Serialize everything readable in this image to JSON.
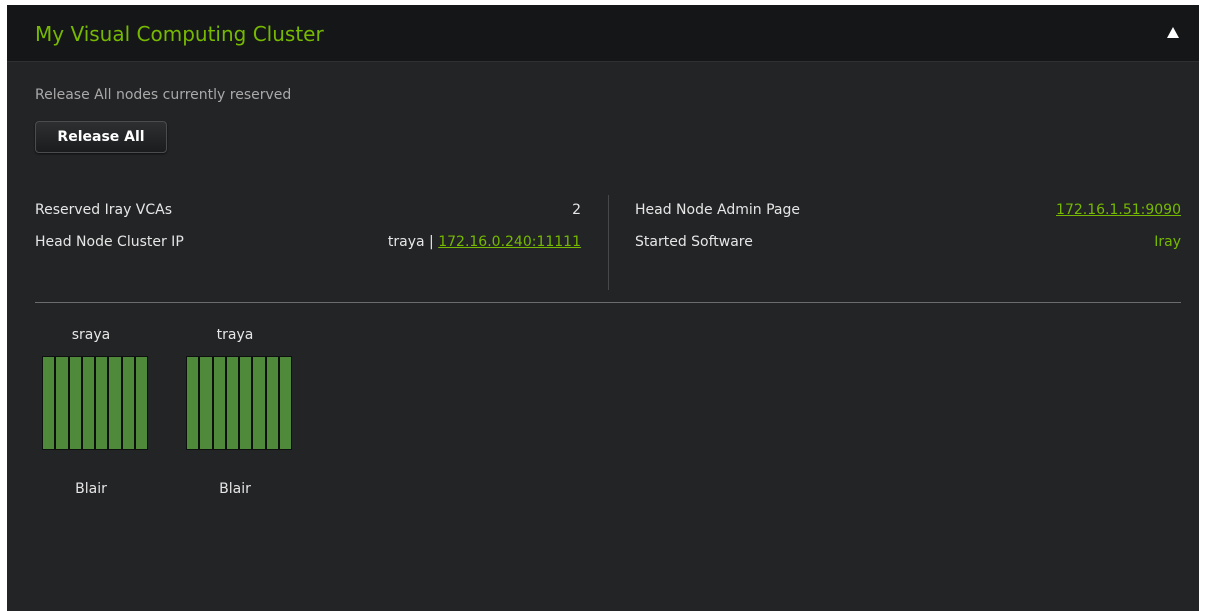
{
  "panel": {
    "title": "My Visual Computing Cluster",
    "collapse_icon": "triangle-up-icon"
  },
  "release": {
    "hint": "Release All nodes currently reserved",
    "button_label": "Release All"
  },
  "info": {
    "reserved_label": "Reserved Iray VCAs",
    "reserved_value": "2",
    "cluster_ip_label": "Head Node Cluster IP",
    "cluster_ip_host": "traya",
    "cluster_ip_separator": " | ",
    "cluster_ip_link": "172.16.0.240:11111",
    "admin_page_label": "Head Node Admin Page",
    "admin_page_link": "172.16.1.51:9090",
    "software_label": "Started Software",
    "software_value": "Iray"
  },
  "nodes": [
    {
      "name": "sraya",
      "type": "Blair",
      "slots": 8
    },
    {
      "name": "traya",
      "type": "Blair",
      "slots": 8
    }
  ],
  "colors": {
    "accent": "#76b900",
    "slot_fill": "#4f8a3a",
    "panel_bg": "#222426",
    "header_bg": "#151617"
  }
}
